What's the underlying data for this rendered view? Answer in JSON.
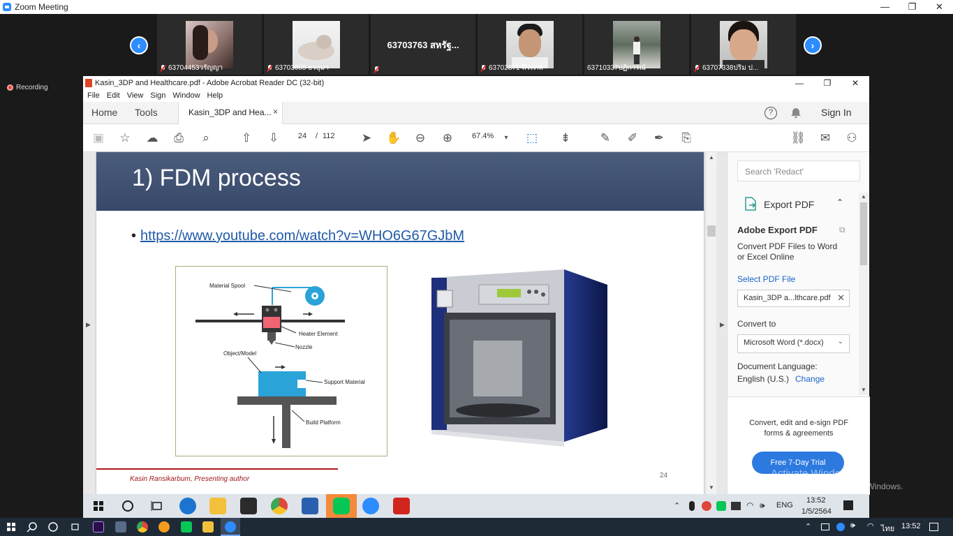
{
  "zoom": {
    "title": "Zoom Meeting",
    "window_controls": [
      "—",
      "❐",
      "✕"
    ],
    "recording_label": "Recording",
    "participants": [
      {
        "name": "63704453วรัญญา",
        "muted": true,
        "has_video": true
      },
      {
        "name": "63703605 ธรอุมา",
        "muted": true,
        "has_video": true
      },
      {
        "name": "63703763 สหรัฐ...",
        "muted": true,
        "has_video": false
      },
      {
        "name": "63702871 พีระภพ",
        "muted": true,
        "has_video": true
      },
      {
        "name": "63710337ปฏิการณ์",
        "muted": false,
        "has_video": true
      },
      {
        "name": "63707338ปริม ป...",
        "muted": true,
        "has_video": true
      }
    ],
    "nav_prev": "‹",
    "nav_next": "›"
  },
  "acrobat": {
    "title": "Kasin_3DP and Healthcare.pdf - Adobe Acrobat Reader DC (32-bit)",
    "window_controls": [
      "—",
      "❐",
      "✕"
    ],
    "menu": [
      "File",
      "Edit",
      "View",
      "Sign",
      "Window",
      "Help"
    ],
    "tabs": {
      "home": "Home",
      "tools": "Tools",
      "doc": "Kasin_3DP and Hea...",
      "close": "×"
    },
    "help_icon": "?",
    "sign_in": "Sign In",
    "toolbar": {
      "current_page": "24",
      "page_sep": "/",
      "total_pages": "112",
      "zoom": "67.4%"
    },
    "page": {
      "title": "1) FDM process",
      "bullet": "•",
      "link": "https://www.youtube.com/watch?v=WHO6G67GJbM",
      "author": "Kasin Ransikarbum, Presenting author",
      "page_number": "24",
      "diagram_labels": {
        "spool": "Material Spool",
        "heater": "Heater Element",
        "nozzle": "Nozzle",
        "object": "Object/Model",
        "support": "Support Material",
        "platform": "Build Platform"
      }
    },
    "right_pane": {
      "search_placeholder": "Search 'Redact'",
      "export_label": "Export PDF",
      "adobe_export_title": "Adobe Export PDF",
      "convert_desc": "Convert PDF Files to Word or Excel Online",
      "select_file": "Select PDF File",
      "file_name": "Kasin_3DP a...lthcare.pdf",
      "convert_to": "Convert to",
      "format": "Microsoft Word (*.docx)",
      "doc_lang": "Document Language:",
      "lang_value": "English (U.S.)",
      "change": "Change",
      "promo": "Convert, edit and e-sign PDF forms & agreements",
      "trial": "Free 7-Day Trial"
    }
  },
  "activate": {
    "line1": "Activate Windows",
    "line2": "Go to Settings to activate Windows."
  },
  "inner_taskbar": {
    "lang": "ENG",
    "time": "13:52",
    "date": "1/5/2564"
  },
  "outer_taskbar": {
    "lang": "ไทย",
    "time": "13:52"
  }
}
